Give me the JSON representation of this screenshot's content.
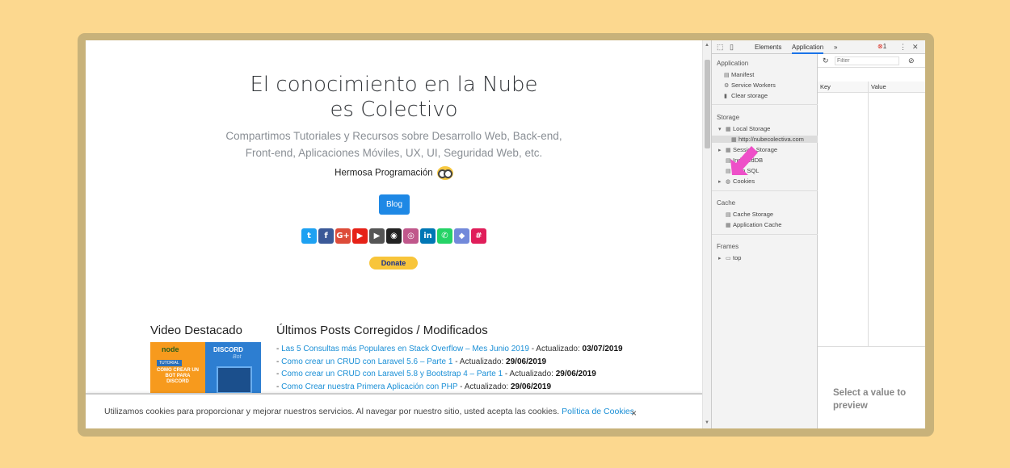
{
  "site": {
    "title_line1": "El conocimiento en la Nube",
    "title_line2": "es Colectivo",
    "subtitle_line1": "Compartimos Tutoriales y Recursos sobre Desarrollo Web, Back-end,",
    "subtitle_line2": "Front-end, Aplicaciones Móviles, UX, UI, Seguridad Web, etc.",
    "hermosa": "Hermosa Programación",
    "blog_button": "Blog",
    "donate_button": "Donate",
    "socials": [
      {
        "name": "twitter",
        "glyph": "t",
        "color": "#1da1f2"
      },
      {
        "name": "facebook",
        "glyph": "f",
        "color": "#3b5998"
      },
      {
        "name": "google-plus",
        "glyph": "G+",
        "color": "#dd4b39"
      },
      {
        "name": "youtube",
        "glyph": "▶",
        "color": "#e62117"
      },
      {
        "name": "youtube-2",
        "glyph": "▶",
        "color": "#555555"
      },
      {
        "name": "github",
        "glyph": "◉",
        "color": "#222222"
      },
      {
        "name": "instagram",
        "glyph": "◎",
        "color": "#c0578b"
      },
      {
        "name": "linkedin",
        "glyph": "in",
        "color": "#0077b5"
      },
      {
        "name": "whatsapp",
        "glyph": "✆",
        "color": "#25d366"
      },
      {
        "name": "discord",
        "glyph": "◆",
        "color": "#7289da"
      },
      {
        "name": "slack",
        "glyph": "#",
        "color": "#e01e5a"
      }
    ],
    "video_heading": "Video Destacado",
    "video_thumb": {
      "node": "node",
      "tutorial": "TUTORIAL",
      "text": "COMO CREAR UN BOT PARA DISCORD",
      "discord": "DISCORD",
      "bot": "Bot"
    },
    "posts_heading": "Últimos Posts Corregidos / Modificados",
    "updated_label": "Actualizado:",
    "posts": [
      {
        "title": "Las 5 Consultas más Populares en Stack Overflow – Mes Junio 2019",
        "date": "03/07/2019"
      },
      {
        "title": "Como crear un CRUD con Laravel 5.6 – Parte 1",
        "date": "29/06/2019"
      },
      {
        "title": "Como crear un CRUD con Laravel 5.8 y Bootstrap 4 – Parte 1",
        "date": "29/06/2019"
      },
      {
        "title": "Como Crear nuestra Primera Aplicación con PHP",
        "date": "29/06/2019"
      }
    ],
    "cookie_text": "Utilizamos cookies para proporcionar y mejorar nuestros servicios. Al navegar por nuestro sitio, usted acepta las cookies.",
    "cookie_link": "Política de Cookies",
    "cookie_close": "×"
  },
  "devtools": {
    "tabs": {
      "elements": "Elements",
      "application": "Application",
      "more": "»"
    },
    "error_count": "1",
    "sidebar": {
      "application_header": "Application",
      "application_items": [
        "Manifest",
        "Service Workers",
        "Clear storage"
      ],
      "storage_header": "Storage",
      "local_storage": "Local Storage",
      "local_storage_origin": "http://nubecolectiva.com",
      "storage_items": [
        "Session Storage",
        "IndexedDB",
        "Web SQL",
        "Cookies"
      ],
      "cache_header": "Cache",
      "cache_items": [
        "Cache Storage",
        "Application Cache"
      ],
      "frames_header": "Frames",
      "frames_items": [
        "top"
      ]
    },
    "filter_placeholder": "Filter",
    "table_headers": {
      "key": "Key",
      "value": "Value"
    },
    "preview_text": "Select a value to preview"
  },
  "colors": {
    "background": "#fcd88f",
    "frame": "#c8b27a",
    "accent_blue": "#1e88e5",
    "arrow": "#ee4fc8",
    "link": "#1a8fd6"
  }
}
